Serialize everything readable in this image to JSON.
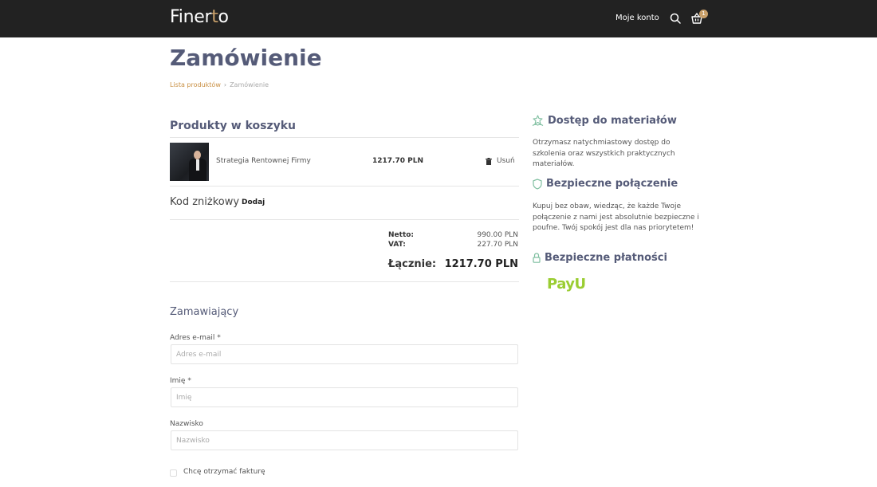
{
  "header": {
    "logo_main": "Finer",
    "logo_accent": "t",
    "logo_end": "o",
    "account_label": "Moje konto",
    "cart_count": "1"
  },
  "page": {
    "title": "Zamówienie",
    "breadcrumb": {
      "link": "Lista produktów",
      "current": "Zamówienie"
    }
  },
  "cart": {
    "title": "Produkty w koszyku",
    "items": [
      {
        "name": "Strategia Rentownej Firmy",
        "price": "1217.70 PLN",
        "remove_label": "Usuń"
      }
    ],
    "discount_label": "Kod zniżkowy",
    "discount_add": "Dodaj",
    "netto_label": "Netto:",
    "netto_value": "990.00 PLN",
    "vat_label": "VAT:",
    "vat_value": "227.70 PLN",
    "total_label": "Łącznie:",
    "total_value": "1217.70 PLN"
  },
  "form": {
    "title": "Zamawiający",
    "email_label": "Adres e-mail *",
    "email_placeholder": "Adres e-mail",
    "firstname_label": "Imię *",
    "firstname_placeholder": "Imię",
    "lastname_label": "Nazwisko",
    "lastname_placeholder": "Nazwisko",
    "invoice_label": "Chcę otrzymać fakturę"
  },
  "sidebar": {
    "access_title": "Dostęp do materiałów",
    "access_text": "Otrzymasz natychmiastowy dostęp do szkolenia oraz wszystkich praktycznych materiałów.",
    "secure_title": "Bezpieczne połączenie",
    "secure_text": "Kupuj bez obaw, wiedząc, że każde Twoje połączenie z nami jest absolutnie bezpieczne i poufne. Twój spokój jest dla nas priorytetem!",
    "payment_title": "Bezpieczne płatności",
    "payment_logo": "PayU"
  },
  "colors": {
    "accent": "#c9a06a",
    "heading": "#555b78",
    "topbar": "#222222",
    "icon_green": "#7fbfa0"
  }
}
